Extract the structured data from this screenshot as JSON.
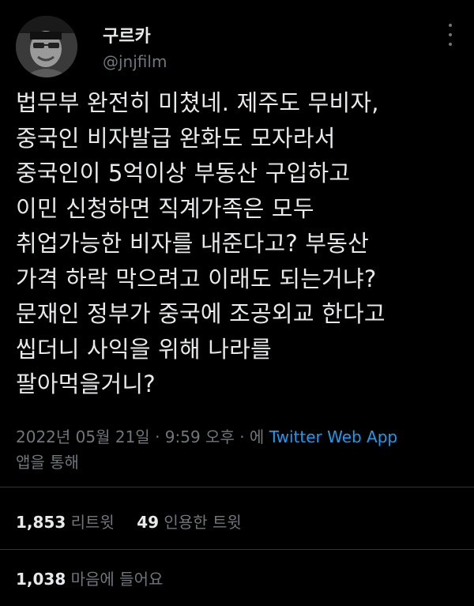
{
  "author": {
    "display_name": "구르카",
    "handle": "@jnjfilm"
  },
  "tweet": {
    "lines": [
      "법무부 완전히 미쳤네. 제주도 무비자,",
      "중국인 비자발급 완화도 모자라서",
      "중국인이 5억이상 부동산 구입하고",
      "이민 신청하면 직계가족은 모두",
      "취업가능한 비자를 내준다고? 부동산",
      "가격 하락 막으려고 이래도 되는거냐?",
      "문재인 정부가 중국에 조공외교 한다고",
      "씹더니 사익을 위해 나라를",
      "팔아먹을거니?"
    ]
  },
  "meta": {
    "timestamp": "2022년 05월 21일 · 9:59 오후",
    "separator": " · 에 ",
    "source": "Twitter Web App",
    "suffix": "앱을 통해"
  },
  "stats": {
    "retweets_count": "1,853",
    "retweets_label": "리트윗",
    "quotes_count": "49",
    "quotes_label": "인용한 트윗",
    "likes_count": "1,038",
    "likes_label": "마음에 들어요"
  },
  "icons": {
    "more": "more-vertical-icon"
  },
  "colors": {
    "background": "#000000",
    "text": "#e7e9ea",
    "muted": "#71767b",
    "link": "#1d9bf0",
    "divider": "#2f3336"
  }
}
